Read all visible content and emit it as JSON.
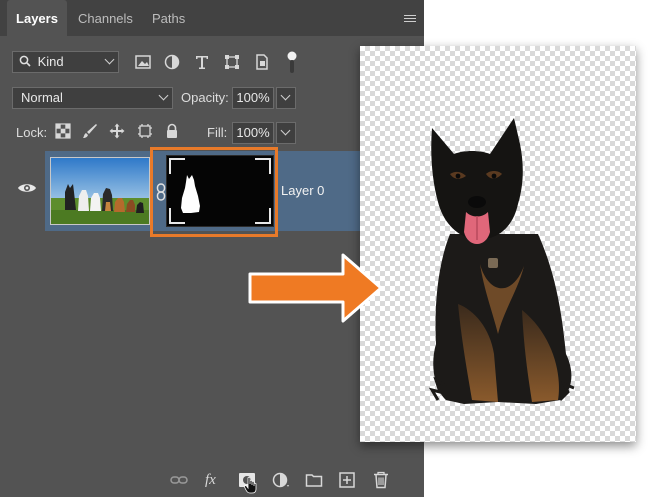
{
  "panel": {
    "tabs": [
      {
        "label": "Layers",
        "active": true
      },
      {
        "label": "Channels",
        "active": false
      },
      {
        "label": "Paths",
        "active": false
      }
    ],
    "filter": {
      "kind_value": "Kind"
    },
    "blend": {
      "mode_value": "Normal",
      "opacity_label": "Opacity:",
      "opacity_value": "100%"
    },
    "lock": {
      "label": "Lock:",
      "fill_label": "Fill:",
      "fill_value": "100%"
    },
    "layer": {
      "name": "Layer 0"
    },
    "bottom_icons": [
      "link-layers-icon",
      "fx-icon",
      "add-mask-icon",
      "adjustment-layer-icon",
      "folder-icon",
      "new-layer-icon",
      "trash-icon"
    ],
    "fx_label": "fx"
  },
  "colors": {
    "panel_bg": "#535353",
    "tabbar_bg": "#424242",
    "selected_row": "#4f6a87",
    "highlight_orange": "#e87a2a",
    "arrow_orange": "#ef7a23"
  }
}
